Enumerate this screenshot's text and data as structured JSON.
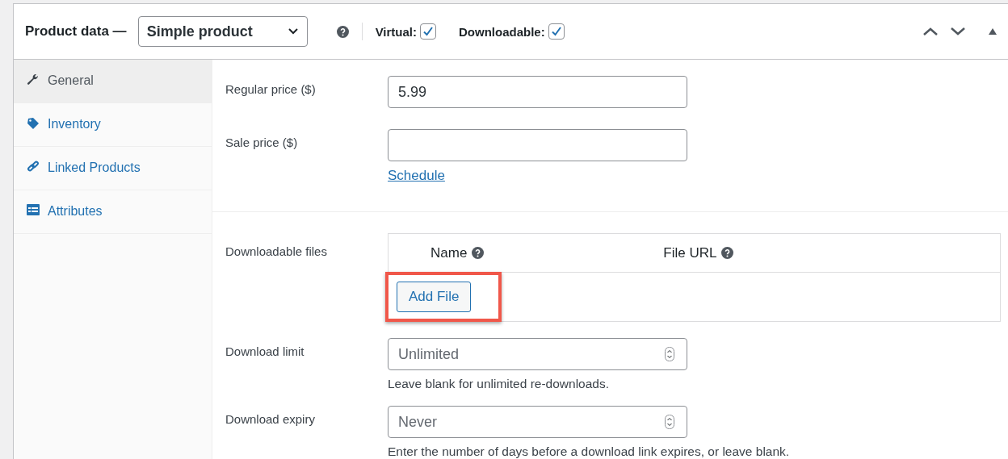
{
  "header": {
    "title": "Product data —",
    "product_type": "Simple product",
    "options": [
      {
        "label": "Virtual:",
        "checked": true
      },
      {
        "label": "Downloadable:",
        "checked": true
      }
    ]
  },
  "tabs": [
    {
      "label": "General",
      "selected": true
    },
    {
      "label": "Inventory",
      "selected": false
    },
    {
      "label": "Linked Products",
      "selected": false
    },
    {
      "label": "Attributes",
      "selected": false
    }
  ],
  "pricing": [
    {
      "label": "Regular price ($)",
      "value": "5.99"
    },
    {
      "label": "Sale price ($)",
      "link": "Schedule"
    }
  ],
  "downloadable_files": {
    "label": "Downloadable files",
    "columns": [
      "Name",
      "File URL"
    ],
    "button": "Add File",
    "highlighted": true
  },
  "download_fields": [
    {
      "label": "Download limit",
      "placeholder": "Unlimited",
      "hint": "Leave blank for unlimited re-downloads."
    },
    {
      "label": "Download expiry",
      "placeholder": "Never",
      "hint": "Enter the number of days before a download link expires, or leave blank."
    }
  ]
}
